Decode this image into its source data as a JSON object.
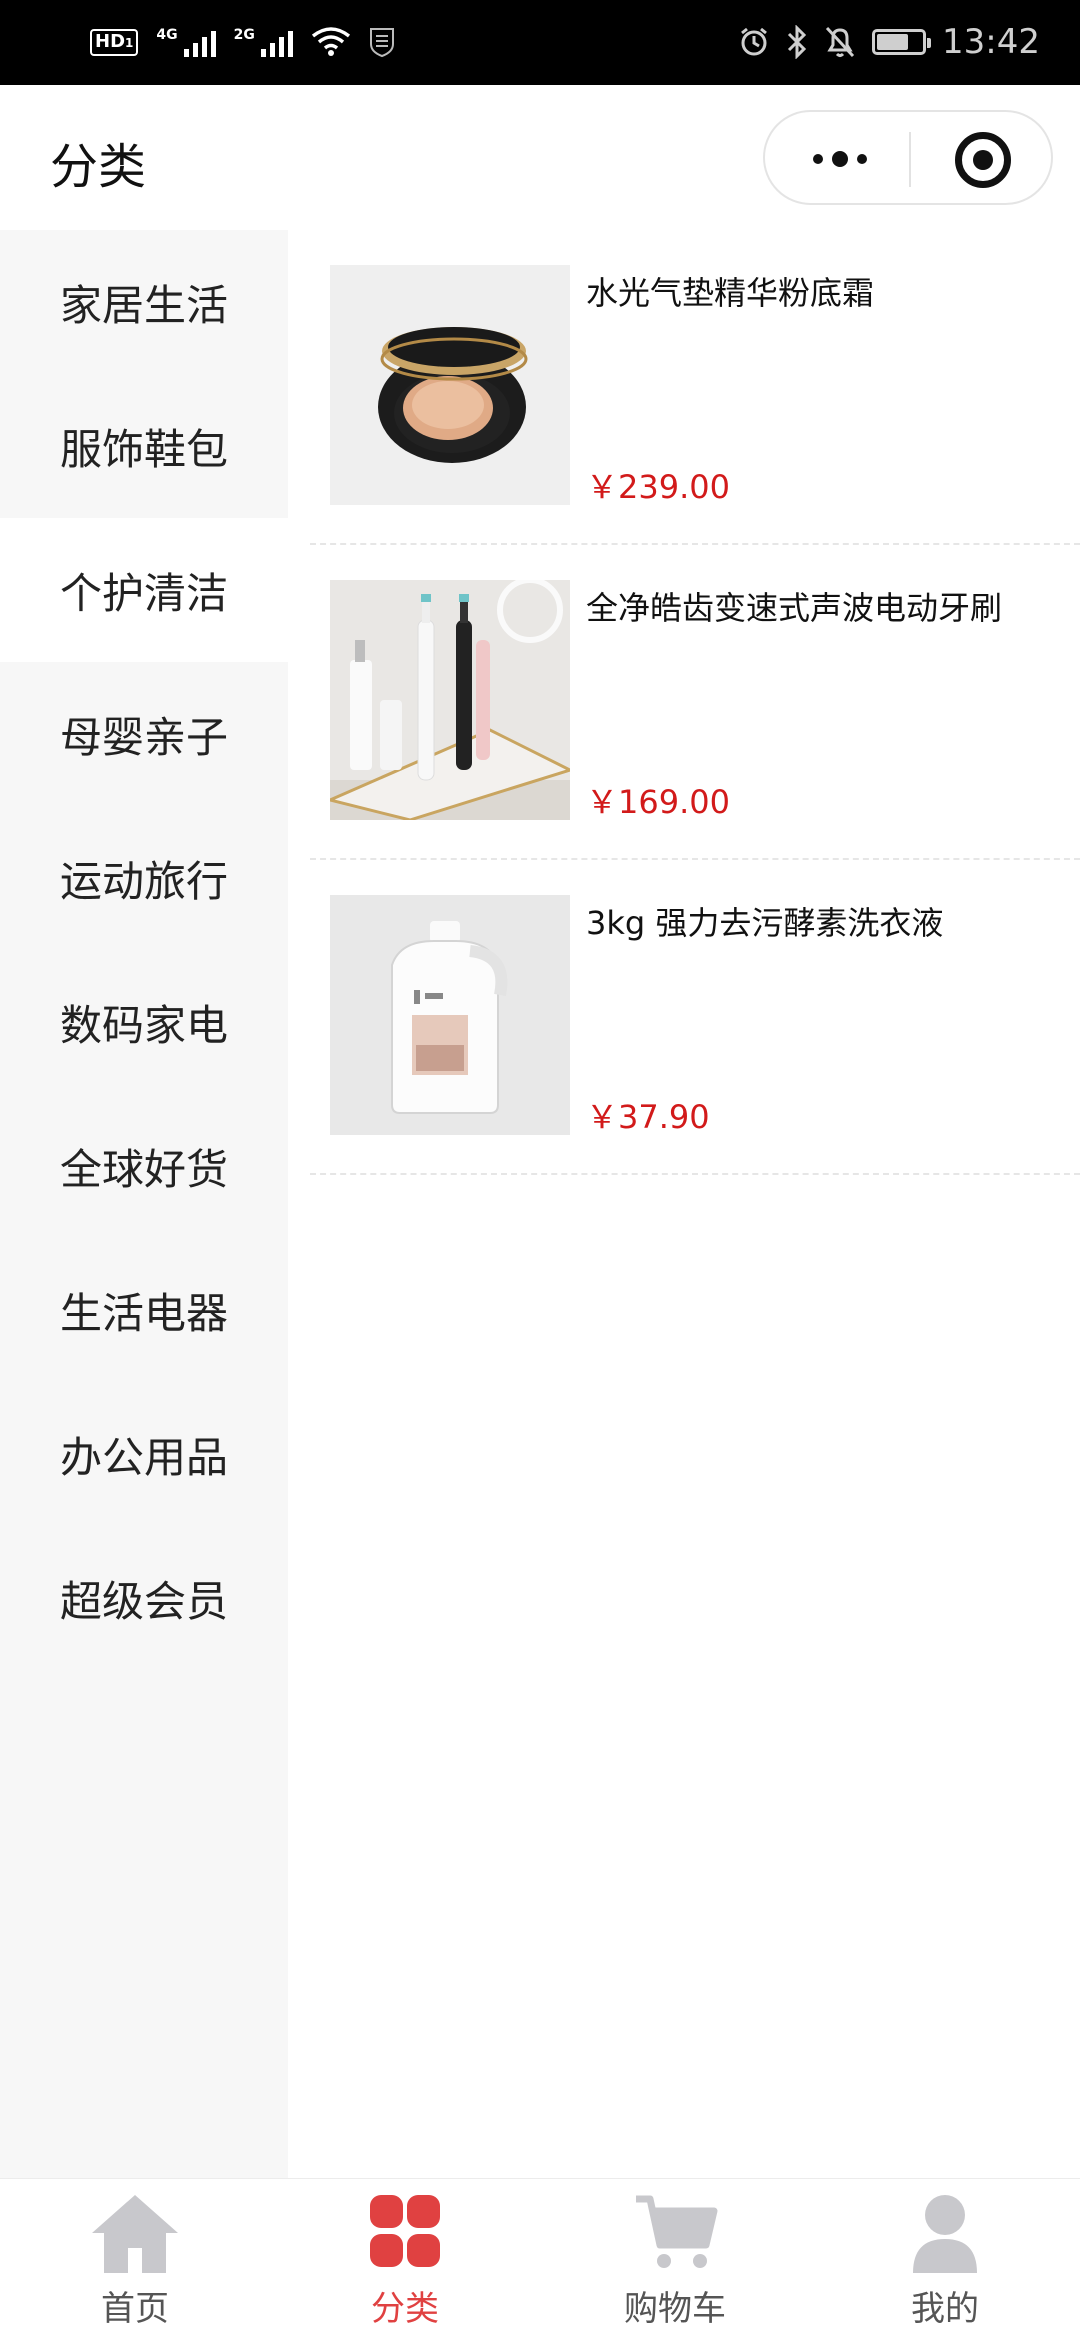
{
  "status_bar": {
    "hd_label": "HD",
    "hd_sub": "1",
    "network_1": "4G",
    "network_2": "2G",
    "time": "13:42",
    "battery_level": 0.7
  },
  "header": {
    "title": "分类"
  },
  "sidebar": {
    "items": [
      {
        "label": "家居生活",
        "active": false
      },
      {
        "label": "服饰鞋包",
        "active": false
      },
      {
        "label": "个护清洁",
        "active": true
      },
      {
        "label": "母婴亲子",
        "active": false
      },
      {
        "label": "运动旅行",
        "active": false
      },
      {
        "label": "数码家电",
        "active": false
      },
      {
        "label": "全球好货",
        "active": false
      },
      {
        "label": "生活电器",
        "active": false
      },
      {
        "label": "办公用品",
        "active": false
      },
      {
        "label": "超级会员",
        "active": false
      }
    ]
  },
  "products": [
    {
      "name": "水光气垫精华粉底霜",
      "price": "￥239.00",
      "image": "cushion-compact-image"
    },
    {
      "name": "全净皓齿变速式声波电动牙刷",
      "price": "￥169.00",
      "image": "electric-toothbrush-image"
    },
    {
      "name": "3kg 强力去污酵素洗衣液",
      "price": "￥37.90",
      "image": "laundry-detergent-image"
    }
  ],
  "tabbar": {
    "tabs": [
      {
        "label": "首页",
        "icon": "home-icon",
        "active": false
      },
      {
        "label": "分类",
        "icon": "category-icon",
        "active": true
      },
      {
        "label": "购物车",
        "icon": "cart-icon",
        "active": false
      },
      {
        "label": "我的",
        "icon": "profile-icon",
        "active": false
      }
    ]
  },
  "colors": {
    "accent": "#e04141",
    "price": "#d21a1a",
    "sidebar_bg": "#f7f7f7",
    "inactive_icon": "#c8c8cc"
  }
}
